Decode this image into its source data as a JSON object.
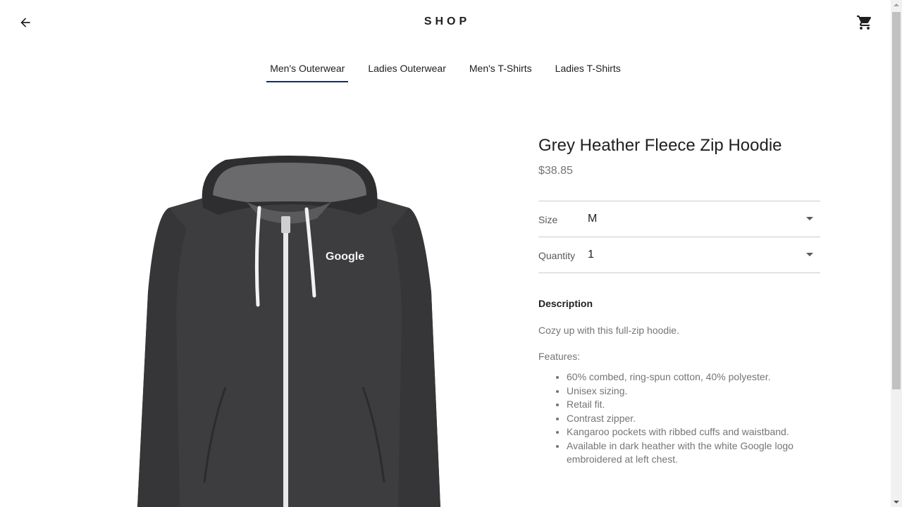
{
  "header": {
    "logo": "SHOP",
    "back_icon": "arrow-back-icon",
    "cart_icon": "shopping-cart-icon"
  },
  "tabs": [
    {
      "label": "Men's Outerwear",
      "active": true
    },
    {
      "label": "Ladies Outerwear",
      "active": false
    },
    {
      "label": "Men's T-Shirts",
      "active": false
    },
    {
      "label": "Ladies T-Shirts",
      "active": false
    }
  ],
  "product": {
    "title": "Grey Heather Fleece Zip Hoodie",
    "price": "$38.85",
    "image_logo_text": "Google",
    "size": {
      "label": "Size",
      "value": "M"
    },
    "quantity": {
      "label": "Quantity",
      "value": "1"
    },
    "description_heading": "Description",
    "description": "Cozy up with this full-zip hoodie.",
    "features_label": "Features:",
    "features": [
      "60% combed, ring-spun cotton, 40% polyester.",
      "Unisex sizing.",
      "Retail fit.",
      "Contrast zipper.",
      "Kangaroo pockets with ribbed cuffs and waistband.",
      "Available in dark heather with the white Google logo embroidered at left chest."
    ]
  },
  "colors": {
    "accent": "#172c50",
    "text": "#202020",
    "muted": "#757575",
    "divider": "#cccccc"
  }
}
